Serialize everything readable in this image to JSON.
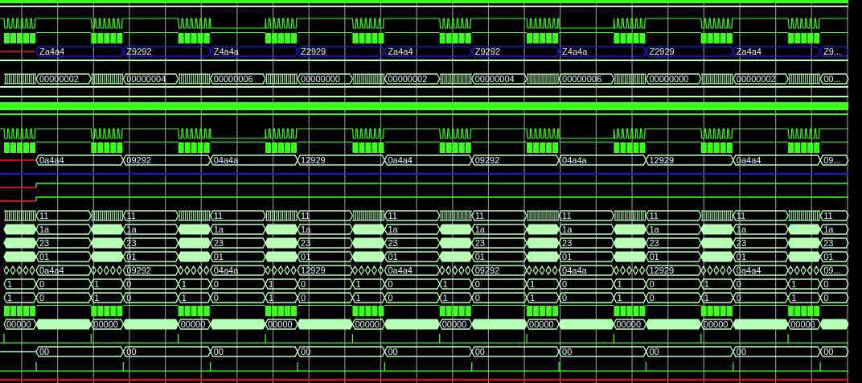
{
  "signals": [
    {
      "kind": "bar"
    },
    {
      "kind": "line",
      "color": "#b8ffb8"
    },
    {
      "kind": "clock"
    },
    {
      "kind": "blocks"
    },
    {
      "kind": "bus",
      "color": "#1a1ae0",
      "undefined_start": true,
      "values": [
        "Za4a4",
        "Z9292",
        "Z4a4a",
        "Z2929",
        "Za4a4",
        "Z9292",
        "Z4a4a",
        "Z2929",
        "Za4a4",
        "Z9..."
      ]
    },
    {
      "kind": "line",
      "color": "#b8ffb8"
    },
    {
      "kind": "hatchbus",
      "values": [
        "00000002",
        "00000004",
        "00000006",
        "00000000",
        "00000002",
        "00000004",
        "00000006",
        "00000000",
        "00000002",
        "00..."
      ]
    },
    {
      "kind": "line",
      "color": "#b8ffb8"
    },
    {
      "kind": "line",
      "color": "#b8ffb8"
    },
    {
      "kind": "bar"
    },
    {
      "kind": "line",
      "color": "#3cff1e"
    },
    {
      "kind": "clock"
    },
    {
      "kind": "blocks"
    },
    {
      "kind": "bus",
      "color": "#b8ffb8",
      "undefined_start": true,
      "values": [
        "0a4a4",
        "09292",
        "04a4a",
        "12929",
        "0a4a4",
        "09292",
        "04a4a",
        "12929",
        "0a4a4",
        "09..."
      ]
    },
    {
      "kind": "line",
      "color": "#1a1ae0"
    },
    {
      "kind": "step"
    },
    {
      "kind": "step"
    },
    {
      "kind": "hatchbus",
      "values": [
        "11",
        "11",
        "11",
        "11",
        "11",
        "11",
        "11",
        "11",
        "11",
        "11"
      ]
    },
    {
      "kind": "solidbus",
      "values": [
        "1a",
        "1a",
        "1a",
        "1a",
        "1a",
        "1a",
        "1a",
        "1a",
        "1a",
        "1a"
      ]
    },
    {
      "kind": "solidbus",
      "values": [
        "23",
        "23",
        "23",
        "23",
        "23",
        "23",
        "23",
        "23",
        "23",
        "23"
      ]
    },
    {
      "kind": "solidbus",
      "values": [
        "01",
        "01",
        "01",
        "01",
        "01",
        "01",
        "01",
        "01",
        "01",
        "01"
      ]
    },
    {
      "kind": "glitchbus",
      "values": [
        "0a4a4",
        "09292",
        "04a4a",
        "12929",
        "0a4a4",
        "09292",
        "04a4a",
        "12929",
        "0a4a4",
        "09..."
      ]
    },
    {
      "kind": "split",
      "values": [
        "1",
        "0",
        "1",
        "0",
        "1",
        "0",
        "1",
        "0",
        "1",
        "0",
        "1",
        "0",
        "1",
        "0",
        "1",
        "0",
        "1",
        "0",
        "1",
        "0"
      ]
    },
    {
      "kind": "split",
      "values": [
        "1",
        "0",
        "1",
        "0",
        "1",
        "0",
        "1",
        "0",
        "1",
        "0",
        "1",
        "0",
        "1",
        "0",
        "1",
        "0",
        "1",
        "0",
        "1",
        "0"
      ]
    },
    {
      "kind": "blocks"
    },
    {
      "kind": "inverted",
      "values": [
        "00000",
        "00000",
        "00000",
        "00000",
        "00000",
        "00000",
        "00000",
        "00000",
        "00000",
        "00000"
      ]
    },
    {
      "kind": "spikes_early"
    },
    {
      "kind": "bus",
      "color": "#b8ffb8",
      "undefined_start": false,
      "values": [
        "00",
        "00",
        "00",
        "00",
        "00",
        "00",
        "00",
        "00",
        "00",
        "00"
      ]
    },
    {
      "kind": "spikes_late"
    },
    {
      "kind": "line",
      "color": "#ff0000"
    }
  ]
}
